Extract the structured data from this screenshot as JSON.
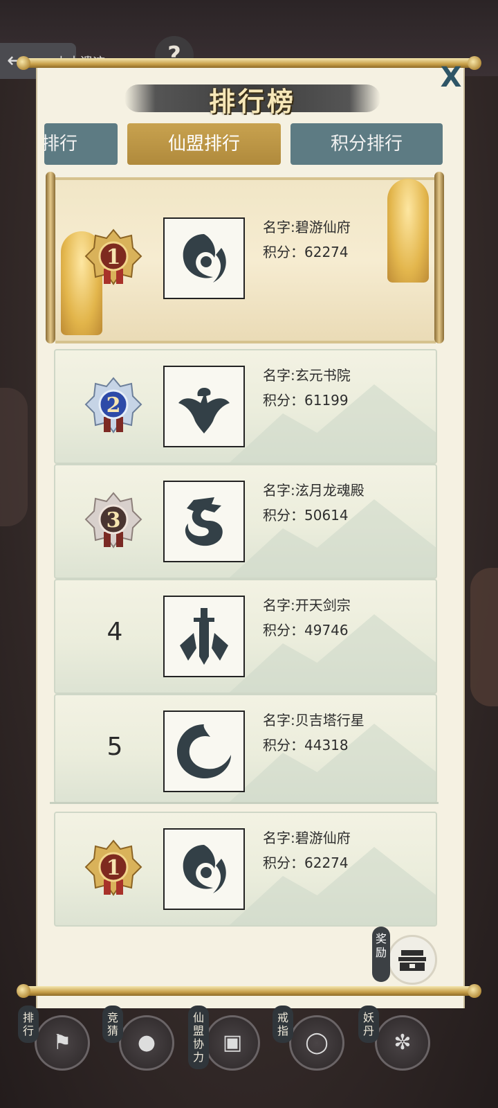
{
  "header": {
    "back_text": "上古遗迹",
    "help_symbol": "?"
  },
  "panel": {
    "title": "排行榜",
    "close_symbol": "X"
  },
  "tabs": [
    {
      "label": "排行"
    },
    {
      "label": "仙盟排行",
      "selected": true
    },
    {
      "label": "积分排行"
    }
  ],
  "rankings": [
    {
      "rank": "1",
      "name_label": "名字:碧游仙府",
      "score_label": "积分：62274",
      "emblem": "swirl-emblem-icon"
    },
    {
      "rank": "2",
      "name_label": "名字:玄元书院",
      "score_label": "积分：61199",
      "emblem": "phoenix-emblem-icon"
    },
    {
      "rank": "3",
      "name_label": "名字:泫月龙魂殿",
      "score_label": "积分：50614",
      "emblem": "dragon-emblem-icon"
    },
    {
      "rank": "4",
      "name_label": "名字:开天剑宗",
      "score_label": "积分：49746",
      "emblem": "sword-emblem-icon"
    },
    {
      "rank": "5",
      "name_label": "名字:贝吉塔行星",
      "score_label": "积分：44318",
      "emblem": "crescent-emblem-icon"
    }
  ],
  "my_guild": {
    "rank": "1",
    "name_label": "名字:碧游仙府",
    "score_label": "积分：62274"
  },
  "reward": {
    "label": "奖励"
  },
  "bottom_nav": [
    {
      "label": "排行",
      "icon": "banner-icon"
    },
    {
      "label": "竞猜",
      "icon": "dice-icon"
    },
    {
      "label": "仙盟协力",
      "icon": "treasure-chest-icon"
    },
    {
      "label": "戒指",
      "icon": "ring-icon"
    },
    {
      "label": "妖丹",
      "icon": "orb-icon"
    }
  ],
  "colors": {
    "tab_selected": "#b08a3c",
    "tab_normal": "#5d7b83",
    "panel_bg": "#f5f1e2",
    "gold_medal": "#a8322a",
    "silver_medal": "#2d4aa8"
  }
}
